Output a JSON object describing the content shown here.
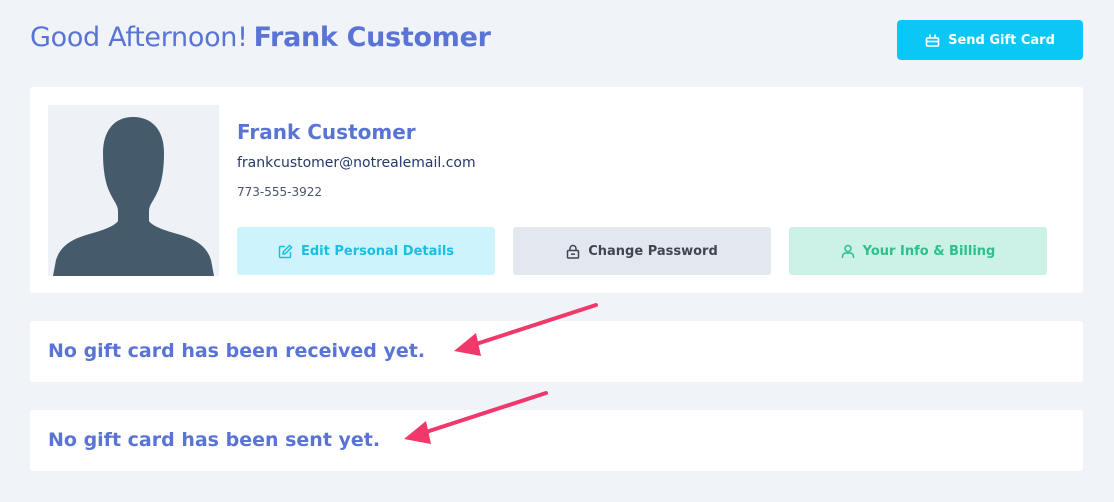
{
  "header": {
    "greeting": "Good Afternoon!",
    "user_name": "Frank Customer",
    "send_gift_card_label": "Send Gift Card",
    "send_gift_card_icon": "gift-icon"
  },
  "profile": {
    "name": "Frank Customer",
    "email": "frankcustomer@notrealemail.com",
    "phone": "773-555-3922",
    "avatar": "avatar-silhouette",
    "actions": [
      {
        "label": "Edit Personal Details",
        "icon": "edit-icon",
        "color": "#1bbde0"
      },
      {
        "label": "Change Password",
        "icon": "lock-icon",
        "color": "#3f4652"
      },
      {
        "label": "Your Info & Billing",
        "icon": "user-icon",
        "color": "#2cc08a"
      }
    ]
  },
  "messages": {
    "received": "No gift card has been received yet.",
    "sent": "No gift card has been sent yet."
  },
  "colors": {
    "page_bg": "#f0f4f8",
    "accent": "#5a74d6",
    "primary_button": "#0bc7f5",
    "annotation_arrow": "#f0386b"
  }
}
